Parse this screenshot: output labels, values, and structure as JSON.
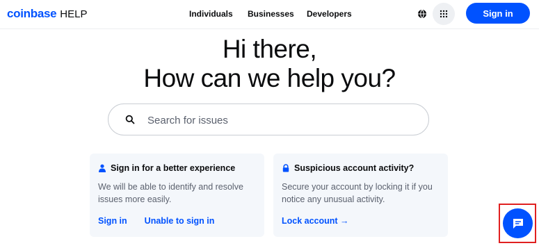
{
  "header": {
    "logo_word": "coinbase",
    "logo_suffix": "HELP",
    "nav": [
      {
        "label": "Individuals"
      },
      {
        "label": "Businesses"
      },
      {
        "label": "Developers"
      }
    ],
    "signin_label": "Sign in"
  },
  "hero": {
    "line1": "Hi there,",
    "line2": "How can we help you?"
  },
  "search": {
    "placeholder": "Search for issues"
  },
  "cards": [
    {
      "icon": "person-icon",
      "title": "Sign in for a better experience",
      "body": "We will be able to identify and resolve issues more easily.",
      "links": [
        "Sign in",
        "Unable to sign in"
      ]
    },
    {
      "icon": "lock-icon",
      "title": "Suspicious account activity?",
      "body": "Secure your account by locking it if you notice any unusual activity.",
      "links": [
        "Lock account →"
      ]
    }
  ],
  "colors": {
    "brand": "#0052ff",
    "card_bg": "#f4f7fb",
    "muted_text": "#5b616e",
    "highlight": "#e02020"
  }
}
